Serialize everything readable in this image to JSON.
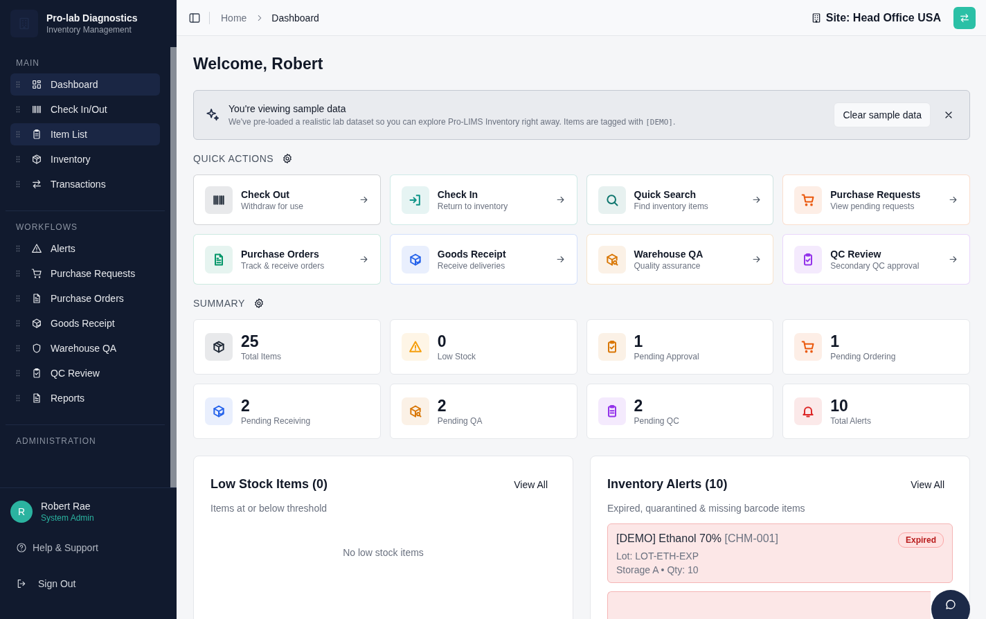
{
  "sidebar": {
    "org_name": "Pro-lab Diagnostics",
    "org_subtitle": "Inventory Management",
    "sections": [
      {
        "title": "MAIN",
        "items": [
          {
            "label": "Dashboard",
            "selected": true
          },
          {
            "label": "Check In/Out",
            "selected": false
          },
          {
            "label": "Item List",
            "selected": true
          },
          {
            "label": "Inventory",
            "selected": false
          },
          {
            "label": "Transactions",
            "selected": false
          }
        ]
      },
      {
        "title": "WORKFLOWS",
        "items": [
          {
            "label": "Alerts",
            "selected": false
          },
          {
            "label": "Purchase Requests",
            "selected": false
          },
          {
            "label": "Purchase Orders",
            "selected": false
          },
          {
            "label": "Goods Receipt",
            "selected": false
          },
          {
            "label": "Warehouse QA",
            "selected": false
          },
          {
            "label": "QC Review",
            "selected": false
          },
          {
            "label": "Reports",
            "selected": false
          }
        ]
      },
      {
        "title": "ADMINISTRATION"
      }
    ],
    "user": {
      "initial": "R",
      "name": "Robert Rae",
      "role": "System Admin"
    },
    "footer_links": [
      "Help & Support",
      "Sign Out"
    ]
  },
  "topbar": {
    "breadcrumbs": [
      "Home",
      "Dashboard"
    ],
    "site": "Site: Head Office USA"
  },
  "welcome": "Welcome, Robert",
  "banner": {
    "title": "You're viewing sample data",
    "text": "We've pre-loaded a realistic lab dataset so you can explore Pro-LIMS Inventory right away. Items are tagged with ",
    "code": "[DEMO]",
    "text_end": ".",
    "button": "Clear sample data"
  },
  "quick_actions": {
    "title": "QUICK ACTIONS",
    "items": [
      {
        "title": "Check Out",
        "subtitle": "Withdraw for use",
        "color": "#1f2937"
      },
      {
        "title": "Check In",
        "subtitle": "Return to inventory",
        "color": "#0d9488"
      },
      {
        "title": "Quick Search",
        "subtitle": "Find inventory items",
        "color": "#0f766e"
      },
      {
        "title": "Purchase Requests",
        "subtitle": "View pending requests",
        "color": "#ea580c"
      },
      {
        "title": "Purchase Orders",
        "subtitle": "Track & receive orders",
        "color": "#059669"
      },
      {
        "title": "Goods Receipt",
        "subtitle": "Receive deliveries",
        "color": "#2563eb"
      },
      {
        "title": "Warehouse QA",
        "subtitle": "Quality assurance",
        "color": "#d97706"
      },
      {
        "title": "QC Review",
        "subtitle": "Secondary QC approval",
        "color": "#9333ea"
      }
    ]
  },
  "summary": {
    "title": "SUMMARY",
    "items": [
      {
        "value": "25",
        "label": "Total Items",
        "color": "#1f2937"
      },
      {
        "value": "0",
        "label": "Low Stock",
        "color": "#f59e0b"
      },
      {
        "value": "1",
        "label": "Pending Approval",
        "color": "#d97706"
      },
      {
        "value": "1",
        "label": "Pending Ordering",
        "color": "#ea580c"
      },
      {
        "value": "2",
        "label": "Pending Receiving",
        "color": "#2563eb"
      },
      {
        "value": "2",
        "label": "Pending QA",
        "color": "#d97706"
      },
      {
        "value": "2",
        "label": "Pending QC",
        "color": "#9333ea"
      },
      {
        "value": "10",
        "label": "Total Alerts",
        "color": "#dc2626"
      }
    ]
  },
  "low_stock": {
    "title": "Low Stock Items (0)",
    "link": "View All",
    "subtitle": "Items at or below threshold",
    "empty": "No low stock items"
  },
  "alerts": {
    "title": "Inventory Alerts (10)",
    "link": "View All",
    "subtitle": "Expired, quarantined & missing barcode items",
    "items": [
      {
        "name": "[DEMO] Ethanol 70%",
        "code": "[CHM-001]",
        "lot": "Lot: LOT-ETH-EXP",
        "location": "Storage A",
        "separator": "•",
        "qty": "Qty: 10",
        "status": "Expired"
      }
    ]
  }
}
